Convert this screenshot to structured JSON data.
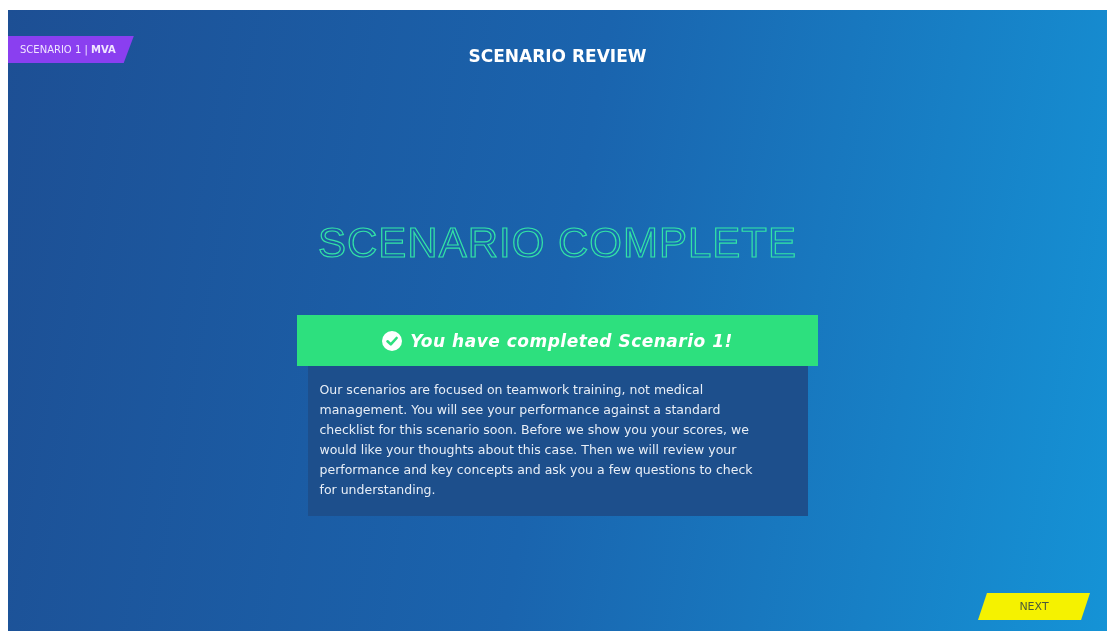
{
  "scenario_tag": "SCENARIO 1 | **MVA**",
  "title": "SCENARIO REVIEW",
  "heading": "SCENARIO COMPLETE",
  "completion_banner": {
    "text": "You have completed Scenario 1!",
    "checked": true
  },
  "message": "Our scenarios are focused on teamwork training, not medical management. You will see your performance against a standard checklist for this scenario soon. Before we show you your scores, we would like your thoughts about this case. Then we will review your performance and key concepts and ask you a few questions to check for understanding.",
  "buttons": [
    {
      "label": "NEXT"
    }
  ]
}
